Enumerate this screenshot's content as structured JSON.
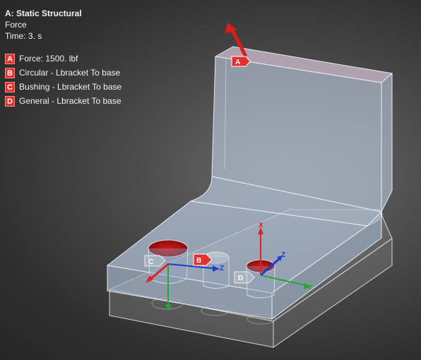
{
  "header": {
    "title": "A: Static Structural",
    "subtitle": "Force",
    "time": "Time: 3. s"
  },
  "legend": [
    {
      "badge": "A",
      "label": "Force: 1500. lbf",
      "color": "#e53030"
    },
    {
      "badge": "B",
      "label": "Circular - Lbracket To base",
      "color": "#e53030"
    },
    {
      "badge": "C",
      "label": "Bushing - Lbracket To base",
      "color": "#e53030"
    },
    {
      "badge": "D",
      "label": "General - Lbracket To base",
      "color": "#e53030"
    }
  ],
  "model_labels": {
    "a": "A",
    "b": "B",
    "c": "C",
    "d": "D"
  },
  "axes": {
    "x": "X",
    "y": "Y",
    "z": "Z"
  },
  "colors": {
    "accent": "#e53030",
    "axis_x": "#e0202a",
    "axis_y": "#22a83a",
    "axis_z": "#1a3ccf"
  }
}
